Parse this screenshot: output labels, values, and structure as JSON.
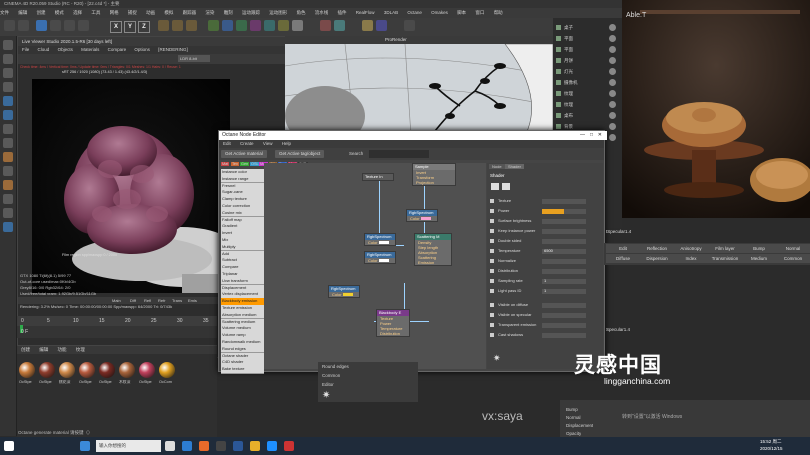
{
  "app": {
    "title": "CINEMA 4D R20.059 Studio (RC - R20) - [22.c4d *] - 主要",
    "menus": [
      "文件",
      "编辑",
      "创建",
      "模式",
      "选择",
      "工具",
      "网格",
      "捕捉",
      "动画",
      "模拟",
      "跟踪器",
      "渲染",
      "雕刻",
      "运动跟踪",
      "运动图形",
      "角色",
      "流水线",
      "插件",
      "RealFlow",
      "3DLAB",
      "Octane",
      "Omakes",
      "脚本",
      "窗口",
      "帮助"
    ]
  },
  "live_viewer": {
    "title": "Live Viewer Studio 2020.1.5-R6 [30 days left]",
    "menus": [
      "File",
      "Cloud",
      "Objects",
      "Materials",
      "Compare",
      "Options",
      "[RENDERING]"
    ],
    "mode": "LDR 8-bit",
    "status_line": "Check time: 4ms / Vertical time: 0ms / Update time: 0ms / Triangles: 0/1 Meshes: 1/1 Hairs: 0 / Reuse: 1",
    "size_line": "sRT 256 / 1920 (1080) (73.43 / 1.43) (43.4/2/1.4/3)",
    "film": "Film region spp/maxspp 0 / 2000",
    "stats": [
      "GTX 1080 Ti(6f)(8.1)   5/99   77",
      "Out-of-core used/max:0Kb/4Gb",
      "Grey8/16: 0/0          Rgb32/64: 2/0",
      "Used/free/total vram: 1.92Gb/9.51Gb/11Gb",
      "Rendering: 3.2%   Ms/sec: 0   Time: 00:00:00/00:00:00   Spp/maxspp: 64/2000   Tri: 0/743k"
    ],
    "mini_tabs": [
      "Main",
      "Diff",
      "Refl",
      "Refr",
      "Trans",
      "Emis"
    ]
  },
  "timeline": {
    "ticks": [
      "0",
      "5",
      "10",
      "15",
      "20",
      "25",
      "30",
      "35"
    ],
    "frame": "0 F"
  },
  "material_manager": {
    "menus": [
      "创建",
      "编辑",
      "功能",
      "纹理"
    ],
    "materials": [
      {
        "name": "OcStpe",
        "color": "#c77a3a"
      },
      {
        "name": "OcStpe",
        "color": "#8f3d2c"
      },
      {
        "name": "桃花深",
        "color": "#d08a4a"
      },
      {
        "name": "OcStpe",
        "color": "#b85b3e"
      },
      {
        "name": "OcStpe",
        "color": "#7a2a22"
      },
      {
        "name": "木纹深",
        "color": "#a8643a"
      },
      {
        "name": "OcStpe",
        "color": "#c0405c"
      },
      {
        "name": "OcCom",
        "color": "#e0a020"
      }
    ]
  },
  "viewport": {
    "label": "ProRender"
  },
  "object_list": {
    "items": [
      "桌子",
      "平面",
      "平面",
      "月饼",
      "灯光",
      "摄像机",
      "纹理",
      "纹理",
      "桌布",
      "背景",
      "地面"
    ]
  },
  "photo": {
    "watermark": "Able.T"
  },
  "node_editor": {
    "title": "Octane Node Editor",
    "menus": [
      "Edit",
      "Create",
      "View",
      "Help"
    ],
    "buttons": [
      "Get Active material",
      "Get Active tag/object"
    ],
    "search_label": "Search",
    "tabs": [
      "Mat",
      "Tex",
      "Gen",
      "OSL",
      "Map",
      "Oth",
      "Emi",
      "Med",
      "C4D"
    ],
    "node_list": [
      "Instance color",
      "Instance range",
      "Fresnel",
      "Sugar-cane",
      "Clamp texture",
      "Color correction",
      "Cosine mix",
      "Falloff map",
      "Gradient",
      "Invert",
      "Mix",
      "Multiply",
      "Add",
      "Subtract",
      "Compare",
      "Triplanar",
      "Uvw transform",
      "Displacement",
      "Vertex displacement",
      "Blackbody emission",
      "Texture emission",
      "Absorption medium",
      "Scattering medium",
      "Volume medium",
      "Volume ramp",
      "Randomwalk medium",
      "Round edges",
      "Octane shader",
      "C4D shader",
      "Bake texture"
    ],
    "selected_node_item": "Blackbody emission",
    "nodes": {
      "texture_in": {
        "title": "Texture In"
      },
      "rgb1": {
        "title": "RgbSpectrum",
        "row": "Color"
      },
      "rgb2": {
        "title": "RgbSpectrum",
        "row": "Color"
      },
      "rgb3": {
        "title": "RgbSpectrum",
        "row": "Color"
      },
      "rgb4": {
        "title": "RgbSpectrum",
        "row": "Color"
      },
      "scattering": {
        "title": "Scattering M",
        "rows": [
          "Density",
          "Step length",
          "Absorption",
          "Scattering",
          "Emission"
        ]
      },
      "blackbody": {
        "title": "Blackbody E",
        "rows": [
          "Texture",
          "Power",
          "Temperature",
          "Distribution"
        ]
      },
      "sample": {
        "title": "Sample",
        "rows": [
          "Invert",
          "Transform",
          "Projection"
        ]
      }
    },
    "props": {
      "tabs": [
        "Node",
        "Shader"
      ],
      "section": "Shader",
      "rows": [
        {
          "label": "Texture",
          "value": ""
        },
        {
          "label": "Power",
          "value": "1"
        },
        {
          "label": "Surface brightness",
          "value": ""
        },
        {
          "label": "Keep instance power",
          "value": ""
        },
        {
          "label": "Double sided",
          "value": ""
        },
        {
          "label": "Temperature",
          "value": "6500"
        },
        {
          "label": "Normalize",
          "value": ""
        },
        {
          "label": "Distribution",
          "value": ""
        },
        {
          "label": "Sampling rate",
          "value": "1"
        },
        {
          "label": "Light pass ID",
          "value": "1"
        },
        {
          "label": "Visible on diffuse",
          "value": ""
        },
        {
          "label": "Visible on specular",
          "value": ""
        },
        {
          "label": "Transparent emission",
          "value": ""
        },
        {
          "label": "Cast shadows",
          "value": ""
        }
      ],
      "power_fill": 0.5
    }
  },
  "material_tabs": {
    "row1": [
      "Edit",
      "Reflection",
      "Anisotropy",
      "Film layer",
      "Bump",
      "Normal"
    ],
    "row2": [
      "Diffuse",
      "Dispersion",
      "Index",
      "Transmission",
      "Medium",
      "Common"
    ],
    "specular_label": "tSpecular1.4",
    "specular2": "Specular1.4"
  },
  "attr_lower": [
    "Round edges",
    "Common",
    "Editor"
  ],
  "attr_right": [
    "Bump",
    "Normal",
    "Displacement",
    "Opacity"
  ],
  "vx_label": "vx:saya",
  "watermark": {
    "cn": "灵感中国",
    "url": "lingganchina.com",
    "win": "转到\"设置\"以激活 Windows"
  },
  "taskbar": {
    "search": "输入你想搜的",
    "time": "15:52 周二",
    "date": "2020/12/15",
    "status_bottom": "Octane generate material 请按键（）"
  }
}
